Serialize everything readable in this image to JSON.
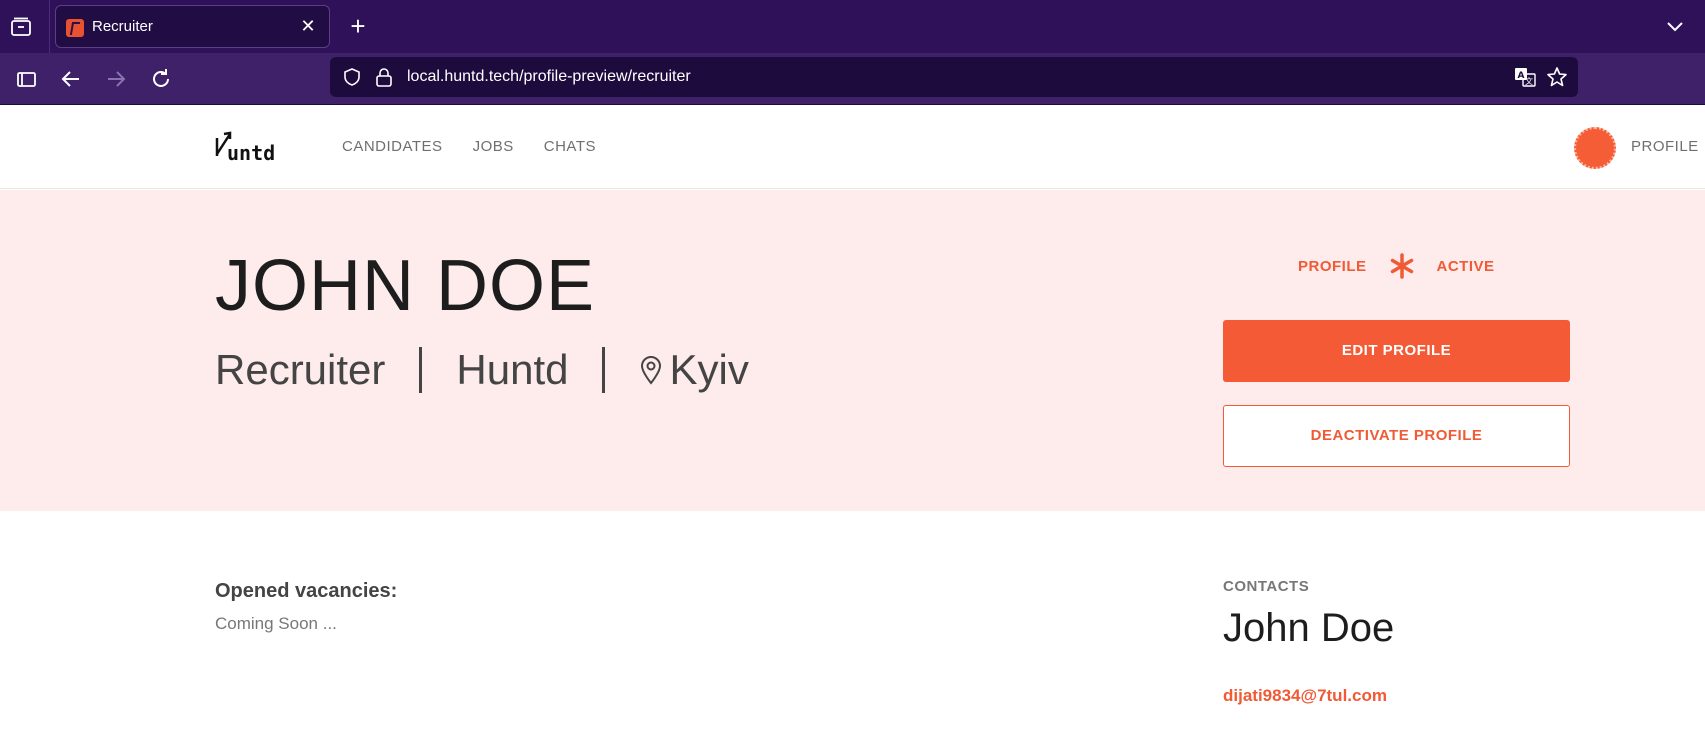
{
  "browser": {
    "tab_title": "Recruiter",
    "url": "local.huntd.tech/profile-preview/recruiter"
  },
  "site": {
    "logo_text": "Huntd",
    "nav": [
      "CANDIDATES",
      "JOBS",
      "CHATS"
    ],
    "profile_label": "PROFILE",
    "accent": "#f45a36"
  },
  "hero": {
    "name": "JOHN DOE",
    "role": "Recruiter",
    "company": "Huntd",
    "location": "Kyiv",
    "status_left": "PROFILE",
    "status_right": "ACTIVE",
    "edit_label": "EDIT PROFILE",
    "deactivate_label": "DEACTIVATE PROFILE"
  },
  "vacancies": {
    "title": "Opened vacancies:",
    "text": "Coming Soon ..."
  },
  "contacts": {
    "label": "CONTACTS",
    "name": "John Doe",
    "email": "dijati9834@7tul.com"
  }
}
